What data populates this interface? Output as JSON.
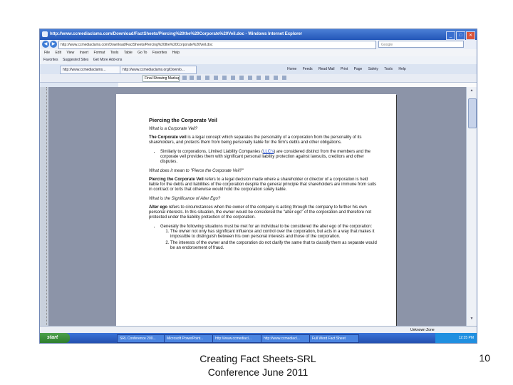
{
  "window": {
    "title": "http://www.ccmediaclams.com/Download/FactSheets/Piercing%20the%20Corporate%20Veil.doc - Windows Internet Explorer",
    "controls": [
      "_",
      "□",
      "✕"
    ]
  },
  "address": {
    "url": "http://www.ccmediaclams.com/Download/FactSheets/Piercing%20the%20Corporate%20Veil.doc",
    "search_placeholder": "Google"
  },
  "menu": [
    "File",
    "Edit",
    "View",
    "Insert",
    "Format",
    "Tools",
    "Table",
    "Go To",
    "Favorites",
    "Help"
  ],
  "favorites": {
    "label": "Favorites",
    "items": [
      "Suggested Sites",
      "Get More Add-ons"
    ]
  },
  "tabs": [
    "http://www.ccmediaclams...",
    "http://www.ccmediaclams.org/Downlo..."
  ],
  "commands": [
    "Home",
    "Feeds",
    "Read Mail",
    "Print",
    "Page",
    "Safety",
    "Tools",
    "Help"
  ],
  "word_toolbar": {
    "view_select": "Final Showing Markup"
  },
  "document": {
    "title": "Piercing the Corporate Veil",
    "q1": "What is a Corporate Veil?",
    "p1_term": "The Corporate veil",
    "p1_rest": " is a legal concept which separates the personality of a corporation from the personality of its shareholders, and protects them from being personally liable for the firm's debts and other obligations.",
    "bullet1_a": "Similarly to corporations, Limited Liability Companies (",
    "bullet1_link": "LLC's",
    "bullet1_b": ") are considered distinct from the members and the corporate veil provides them with significant personal liability protection against lawsuits, creditors and other disputes.",
    "q2": "What does it mean to \"Pierce the Corporate Veil?\"",
    "p2_term": "Piercing the Corporate Veil",
    "p2_rest": " refers to a legal decision made where a shareholder or director of a corporation is held liable for the debts and liabilities of the corporation despite the general principle that shareholders are immune from suits in contract or torts that otherwise would hold the corporation solely liable.",
    "q3": "What is the Significance of Alter Ego?",
    "p3_term": "Alter ego",
    "p3_rest": " refers to circumstances when the owner of the company is acting through the company to further his own personal interests. In this situation, the owner would be considered the \"alter ego\" of the corporation and therefore not protected under the liability protection of the corporation.",
    "bullet2": "Generally the following situations must be met for an individual to be considered the alter ego of the corporation:",
    "sub1": "The owner not only has significant influence and control over the corporation, but acts in a way that makes it impossible to distinguish between his own personal interests and those of the corporation.",
    "sub2": "The interests of the owner and the corporation do not clarify the same that to classify them as separate would be an endorsement of fraud."
  },
  "status": {
    "zone": "Unknown Zone"
  },
  "taskbar": {
    "start": "start",
    "tasks": [
      "SRL Conference 200...",
      "Microsoft PowerPoint...",
      "http://www.ccmediacl...",
      "http://www.ccmediacl...",
      "Full Word Fact Sheet"
    ],
    "clock": "12:35 PM"
  },
  "slide": {
    "caption": "Creating Fact Sheets-SRL Conference June 2011",
    "number": "10"
  }
}
